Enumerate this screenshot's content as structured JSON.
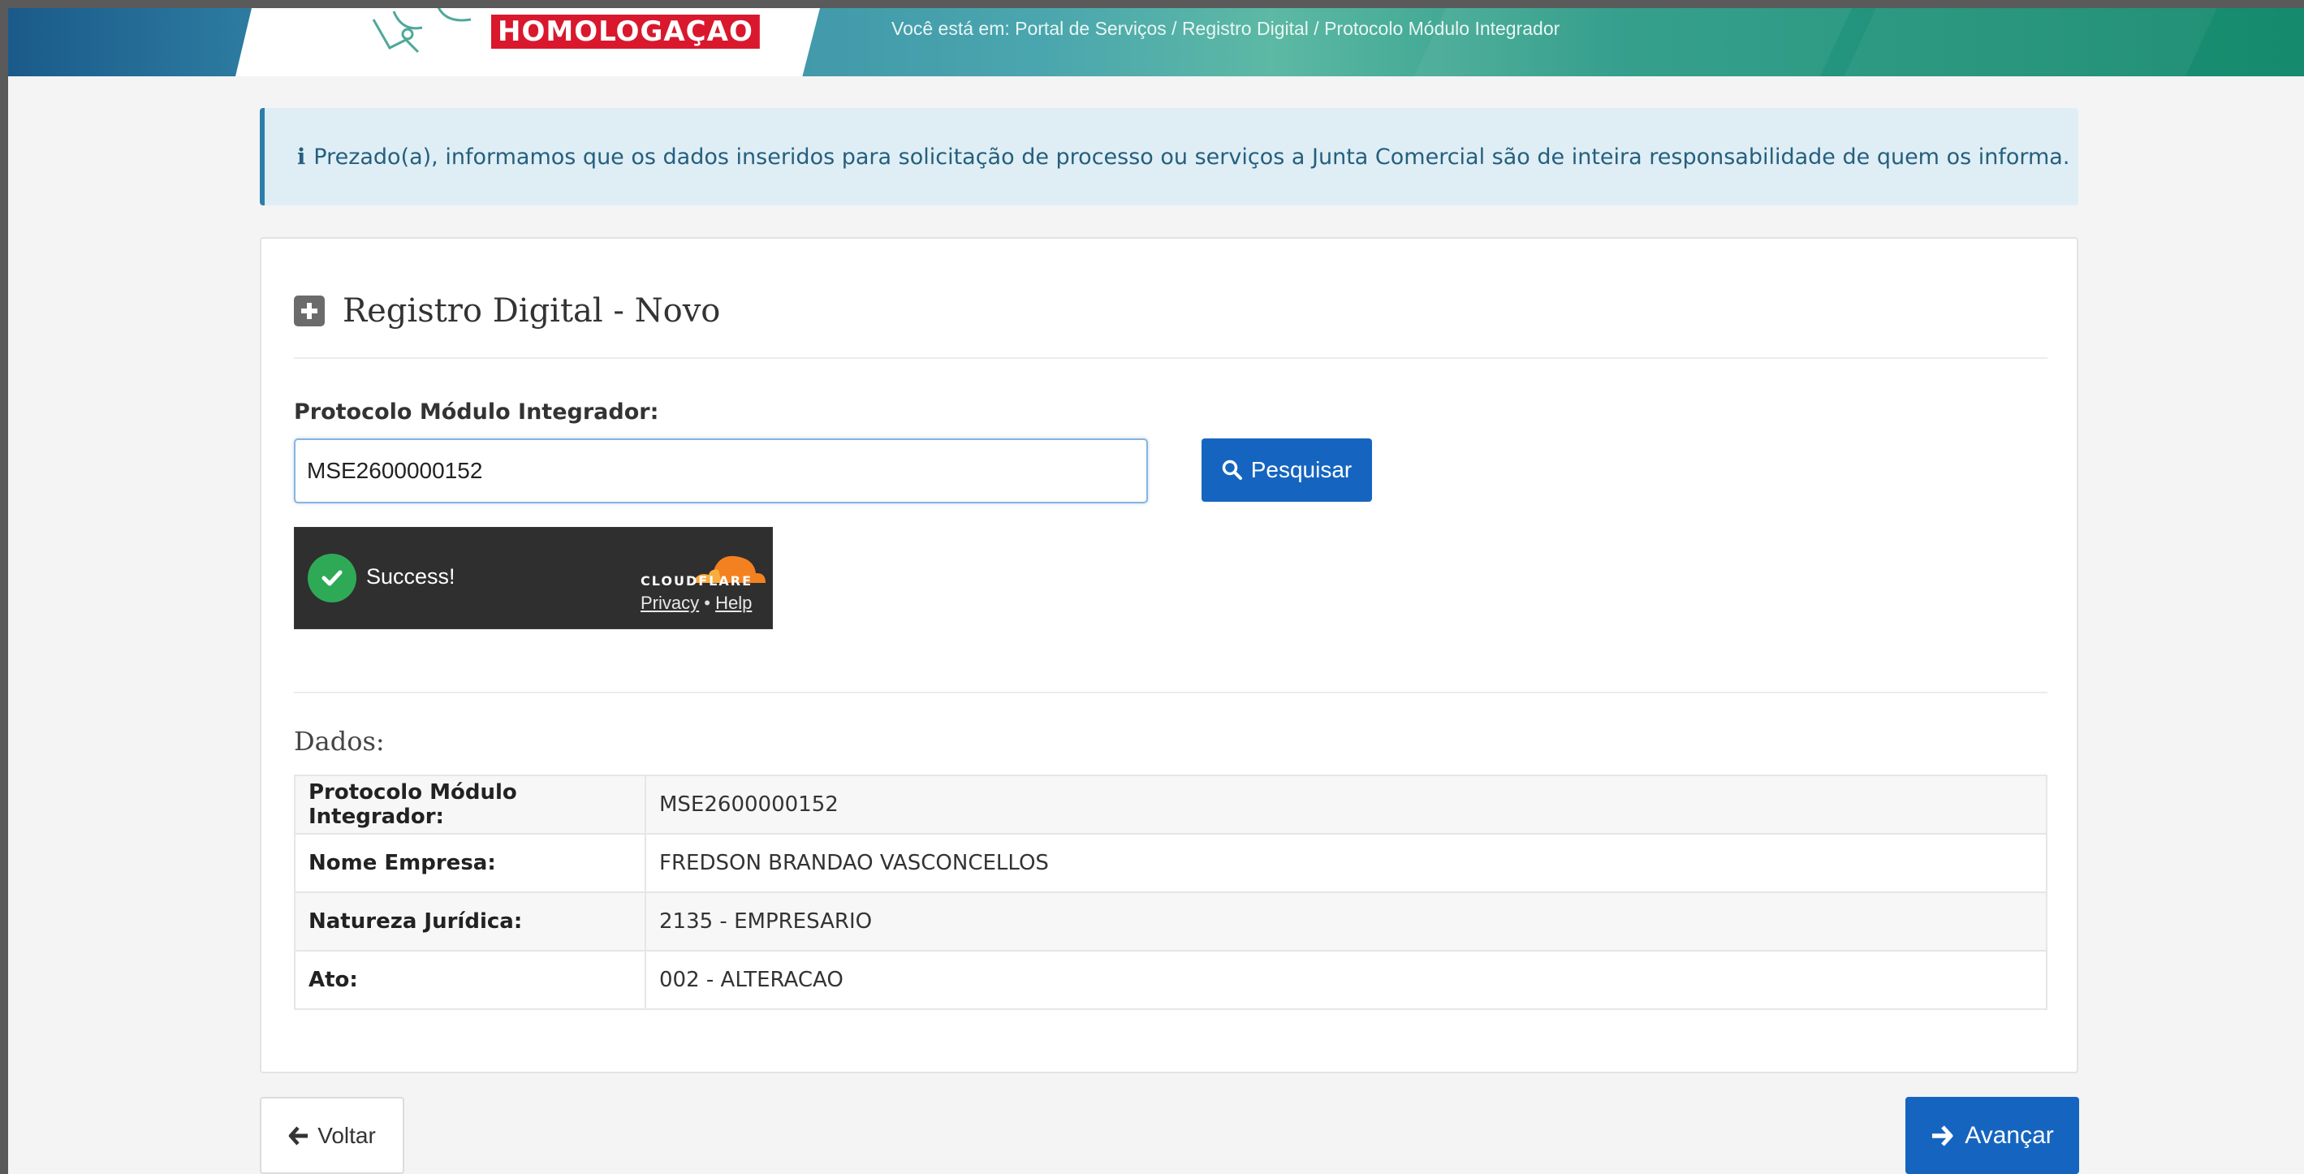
{
  "header": {
    "environment_badge": "HOMOLOGAÇAO",
    "breadcrumb": "Você está em: Portal de Serviços / Registro Digital / Protocolo Módulo Integrador"
  },
  "alert": {
    "icon": "info-icon",
    "text": "Prezado(a), informamos que os dados inseridos para solicitação de processo ou serviços a Junta Comercial são de inteira responsabilidade de quem os informa."
  },
  "panel": {
    "title": "Registro Digital - Novo",
    "field_label": "Protocolo Módulo Integrador:",
    "protocol_value": "MSE2600000152",
    "search_label": "Pesquisar"
  },
  "captcha": {
    "status": "Success!",
    "brand": "CLOUDFLARE",
    "privacy": "Privacy",
    "separator": "•",
    "help": "Help"
  },
  "data": {
    "title": "Dados:",
    "rows": [
      {
        "label": "Protocolo Módulo Integrador:",
        "value": "MSE2600000152"
      },
      {
        "label": "Nome Empresa:",
        "value": "FREDSON BRANDAO VASCONCELLOS"
      },
      {
        "label": "Natureza Jurídica:",
        "value": "2135 - EMPRESARIO"
      },
      {
        "label": "Ato:",
        "value": "002 - ALTERACAO"
      }
    ]
  },
  "footer": {
    "back_label": "Voltar",
    "next_label": "Avançar"
  },
  "colors": {
    "primary": "#1565c0",
    "badge_red": "#d9182d",
    "alert_bg": "#dfeef5",
    "success_green": "#2eaa56",
    "cloudflare_orange": "#f48120"
  }
}
